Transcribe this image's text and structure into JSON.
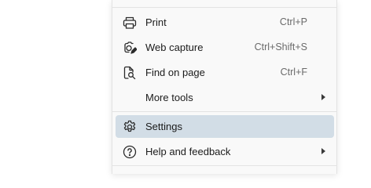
{
  "menu": {
    "items": [
      {
        "label": "Print",
        "shortcut": "Ctrl+P",
        "icon": "printer-icon"
      },
      {
        "label": "Web capture",
        "shortcut": "Ctrl+Shift+S",
        "icon": "web-capture-icon"
      },
      {
        "label": "Find on page",
        "shortcut": "Ctrl+F",
        "icon": "find-on-page-icon"
      },
      {
        "label": "More tools",
        "icon": "chevron-right-icon"
      },
      {
        "label": "Settings",
        "icon": "gear-icon",
        "selected": true
      },
      {
        "label": "Help and feedback",
        "icon": "help-icon"
      }
    ]
  },
  "colors": {
    "menu_background": "#f9f9f9",
    "selected_background": "#d2dde6",
    "divider": "#e3e3e3",
    "text": "#1b1b1b",
    "shortcut_text": "#6a6a6a"
  }
}
